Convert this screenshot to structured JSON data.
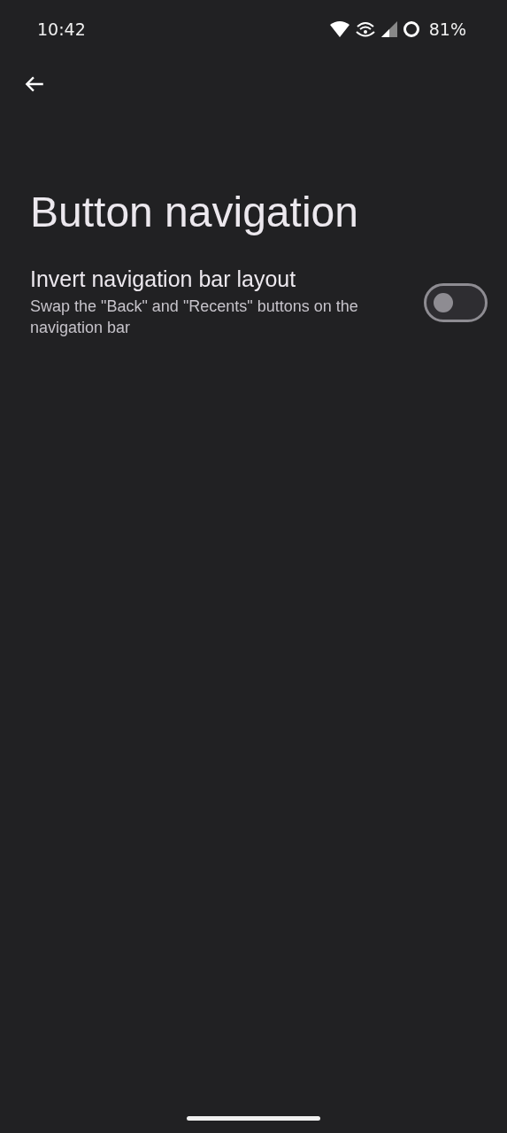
{
  "status_bar": {
    "time": "10:42",
    "battery": "81%"
  },
  "title": "Button navigation",
  "settings": [
    {
      "title": "Invert navigation bar layout",
      "summary": "Swap the \"Back\" and \"Recents\" buttons on the navigation bar",
      "on": false
    }
  ]
}
